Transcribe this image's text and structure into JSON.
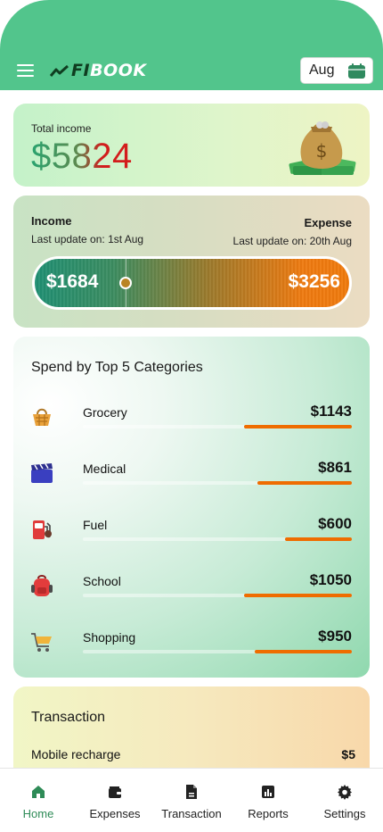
{
  "header": {
    "logo_fi": "FI",
    "logo_book": "BOOK",
    "month": "Aug",
    "bg_color": "#52c58c"
  },
  "total_income": {
    "label": "Total income",
    "value": "$5824",
    "icon": "money-bag-icon"
  },
  "income_expense": {
    "income_title": "Income",
    "income_sub": "Last update on: 1st Aug",
    "expense_title": "Expense",
    "expense_sub": "Last update on: 20th Aug",
    "income_value": "$1684",
    "expense_value": "$3256"
  },
  "categories": {
    "title": "Spend by Top 5 Categories",
    "accent_color": "#ef6c00",
    "items": [
      {
        "name": "Grocery",
        "amount": "$1143",
        "icon": "basket-icon",
        "share": 0.4
      },
      {
        "name": "Medical",
        "amount": "$861",
        "icon": "clapperboard-icon",
        "share": 0.35
      },
      {
        "name": "Fuel",
        "amount": "$600",
        "icon": "fuel-pump-icon",
        "share": 0.25
      },
      {
        "name": "School",
        "amount": "$1050",
        "icon": "backpack-icon",
        "share": 0.4
      },
      {
        "name": "Shopping",
        "amount": "$950",
        "icon": "shopping-cart-icon",
        "share": 0.36
      }
    ]
  },
  "transactions": {
    "title": "Transaction",
    "items": [
      {
        "name": "Mobile recharge",
        "amount": "$5"
      }
    ]
  },
  "nav": {
    "active": "Home",
    "active_color": "#2e8b57",
    "items": [
      {
        "label": "Home",
        "icon": "home-icon"
      },
      {
        "label": "Expenses",
        "icon": "wallet-icon"
      },
      {
        "label": "Transaction",
        "icon": "document-icon"
      },
      {
        "label": "Reports",
        "icon": "bar-chart-icon"
      },
      {
        "label": "Settings",
        "icon": "gear-icon"
      }
    ]
  }
}
